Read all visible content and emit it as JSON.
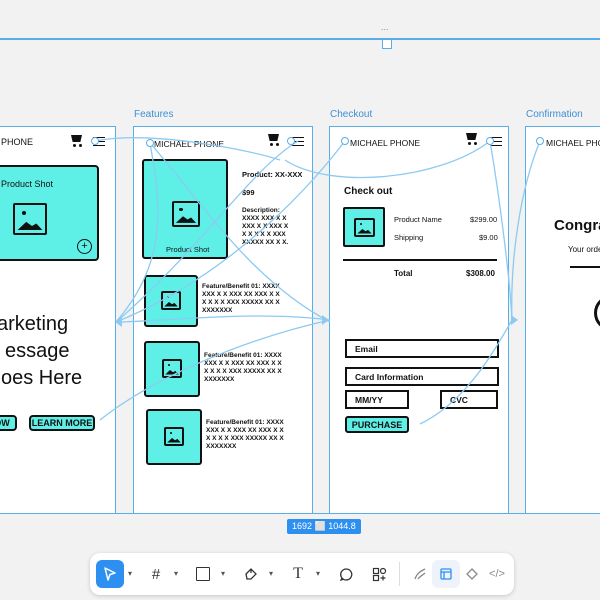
{
  "top_dots": "...",
  "frames": {
    "home": {
      "header": "PHONE",
      "hero_label": "Product Shot",
      "marketing_line1": "arketing",
      "marketing_line2": "essage",
      "marketing_line3": "oes Here",
      "buy_btn": "OW",
      "learn_btn": "LEARN MORE"
    },
    "features": {
      "label": "Features",
      "header": "MICHAEL PHONE",
      "product_shot": "Product Shot",
      "product_title": "Product: XX-XXX",
      "price": "$99",
      "desc_title": "Description:",
      "desc_lines": [
        "XXXX XXX X X",
        "XXX X X XXX X",
        "X X X X X XXX",
        "XXXXX XX X X."
      ],
      "features": [
        {
          "title": "Feature/Benefit 01: XXXX",
          "lines": [
            "XXX X X XXX XX XXX X X",
            "X X X X XXX XXXXX XX X",
            "XXXXXXX"
          ]
        },
        {
          "title": "Feature/Benefit 01: XXXX",
          "lines": [
            "XXX X X XXX XX XXX X X",
            "X X X X XXX XXXXX XX X",
            "XXXXXXX"
          ]
        },
        {
          "title": "Feature/Benefit 01: XXXX",
          "lines": [
            "XXX X X XXX XX XXX X X",
            "X X X X XXX XXXXX XX X",
            "XXXXXXX"
          ]
        }
      ]
    },
    "checkout": {
      "label": "Checkout",
      "header": "MICHAEL PHONE",
      "title": "Check out",
      "product_name": "Product Name",
      "product_price": "$299.00",
      "shipping": "Shipping",
      "shipping_price": "$9.00",
      "total": "Total",
      "total_price": "$308.00",
      "email": "Email",
      "card": "Card Information",
      "mmyy": "MM/YY",
      "cvc": "CVC",
      "purchase": "PURCHASE"
    },
    "confirmation": {
      "label": "Confirmation",
      "header": "MICHAEL PHONE",
      "congrats": "Congra",
      "order": "Your orde"
    }
  },
  "size_badge": "1692 ⬜ 1044.8",
  "toolbar": {
    "icons": [
      "pointer-icon",
      "frame-icon",
      "rectangle-icon",
      "pen-icon",
      "text-icon",
      "comment-icon",
      "components-icon",
      "draw-icon",
      "design-icon",
      "prototype-icon",
      "code-icon"
    ]
  },
  "colors": {
    "accent": "#5ef0e6",
    "selection": "#5aaee8",
    "toolbar_active": "#2d8ff0"
  }
}
